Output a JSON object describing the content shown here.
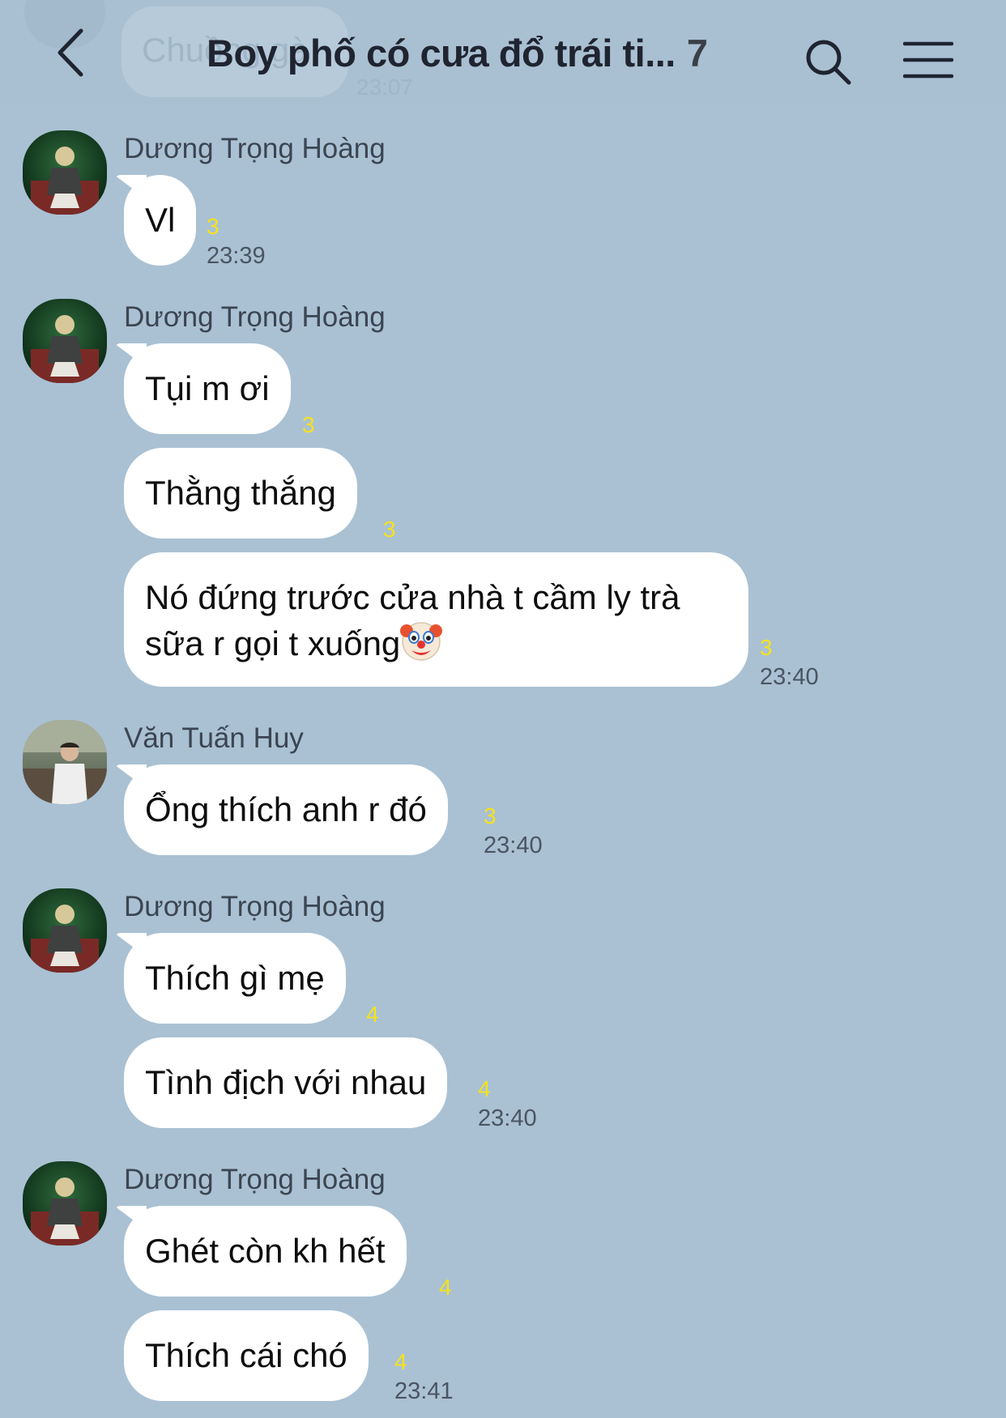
{
  "header": {
    "ghost_text": "Chuồng gà",
    "ghost_time": "23:07",
    "title": "Boy phố có cưa đổ trái ti...",
    "member_count": "7"
  },
  "icons": {
    "back": "chevron-left-icon",
    "search": "search-icon",
    "menu": "hamburger-menu-icon",
    "emoji": "clown-face-icon"
  },
  "colors": {
    "background": "#aac1d3",
    "bubble": "#ffffff",
    "read_count": "#f5e21c"
  },
  "messages": [
    {
      "sender": "Dương Trọng Hoàng",
      "text": "Vl",
      "read": "3",
      "time": "23:39"
    },
    {
      "sender": "Dương Trọng Hoàng",
      "text": "Tụi m ơi",
      "read": "3"
    },
    {
      "text": "Thằng thắng",
      "read": "3"
    },
    {
      "text": "Nó đứng trước cửa nhà t cầm ly trà sữa r gọi t xuống",
      "emoji": "🤡",
      "read": "3",
      "time": "23:40"
    },
    {
      "sender": "Văn Tuấn Huy",
      "text": "Ổng thích anh r đó",
      "read": "3",
      "time": "23:40"
    },
    {
      "sender": "Dương Trọng Hoàng",
      "text": "Thích gì mẹ",
      "read": "4"
    },
    {
      "text": "Tình địch với nhau",
      "read": "4",
      "time": "23:40"
    },
    {
      "sender": "Dương Trọng Hoàng",
      "text": "Ghét còn kh hết",
      "read": "4"
    },
    {
      "text": "Thích cái chó",
      "read": "4",
      "time": "23:41"
    }
  ]
}
